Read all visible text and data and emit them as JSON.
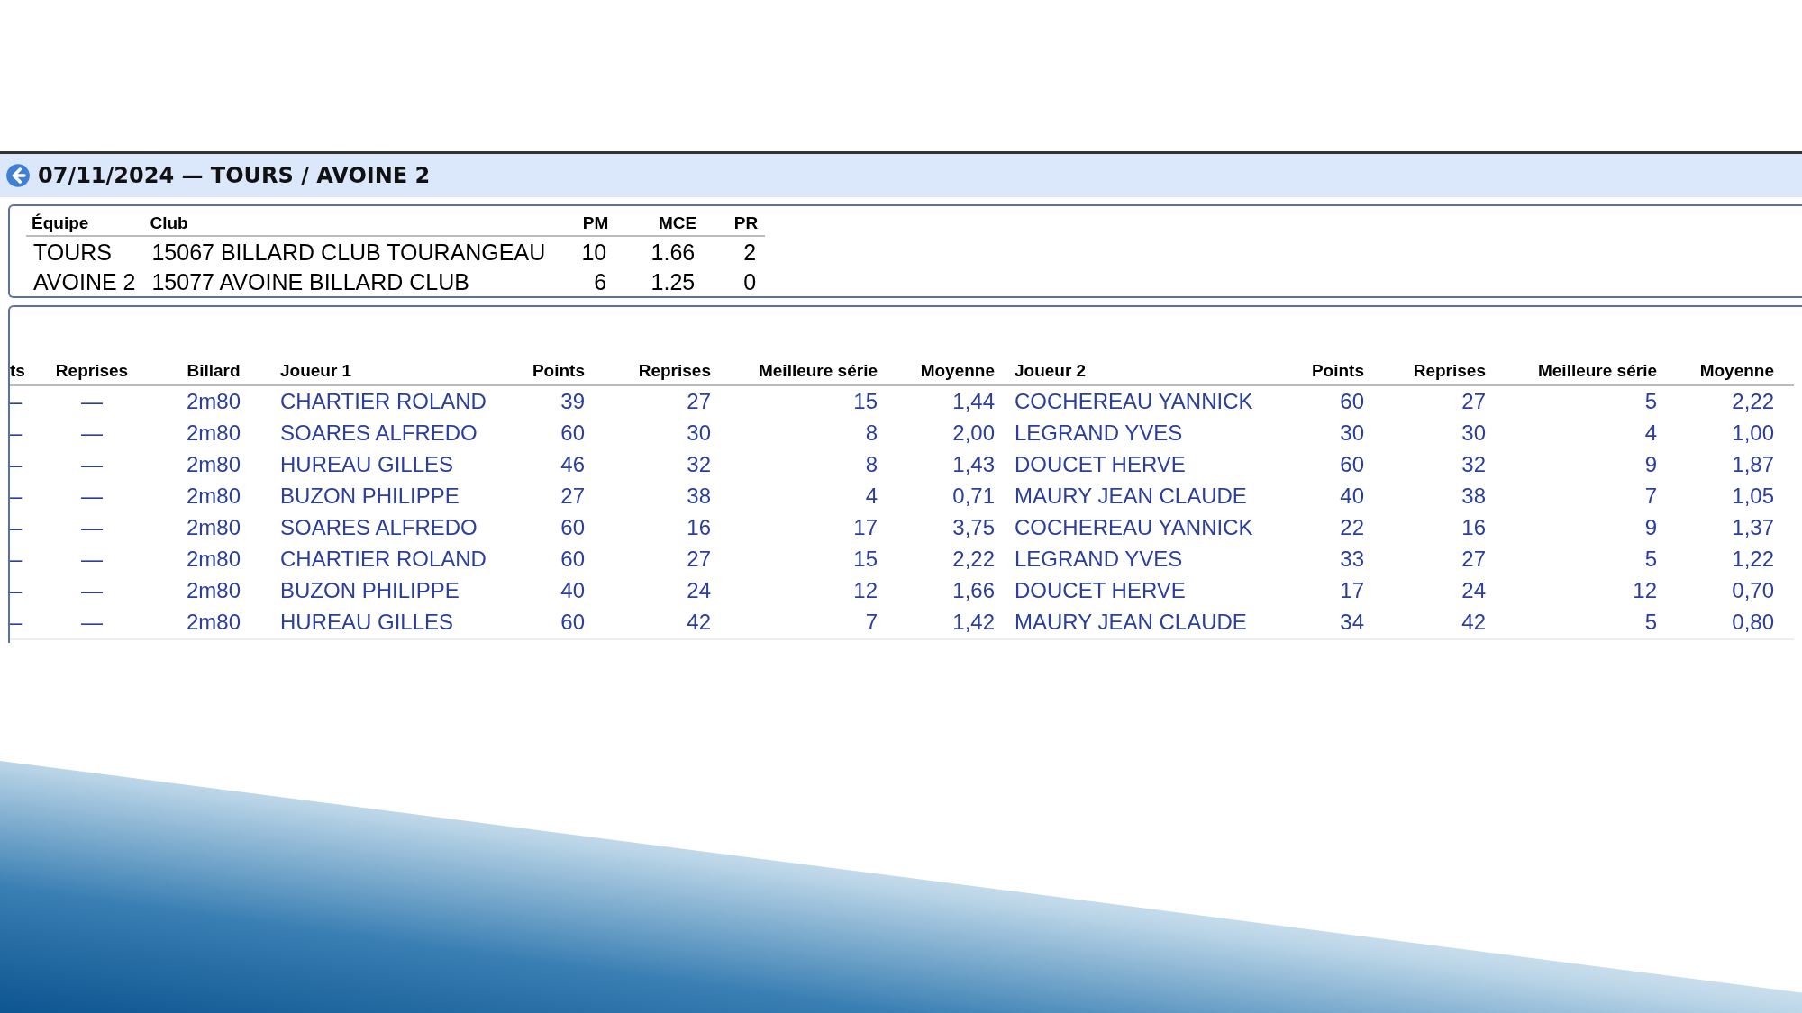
{
  "header": {
    "title": "07/11/2024 — TOURS / AVOINE 2"
  },
  "teams": {
    "columns": [
      "Équipe",
      "Club",
      "PM",
      "MCE",
      "PR"
    ],
    "rows": [
      [
        "TOURS",
        "15067 BILLARD CLUB TOURANGEAU",
        "10",
        "1.66",
        "2"
      ],
      [
        "AVOINE 2",
        "15077 AVOINE BILLARD CLUB",
        "6",
        "1.25",
        "0"
      ]
    ]
  },
  "matches": {
    "columns": [
      "ts",
      "Reprises",
      "Billard",
      "Joueur 1",
      "Points",
      "Reprises",
      "Meilleure série",
      "Moyenne",
      "Joueur 2",
      "Points",
      "Reprises",
      "Meilleure série",
      "Moyenne"
    ],
    "rows": [
      [
        "–",
        "—",
        "2m80",
        "CHARTIER ROLAND",
        "39",
        "27",
        "15",
        "1,44",
        "COCHEREAU YANNICK",
        "60",
        "27",
        "5",
        "2,22"
      ],
      [
        "–",
        "—",
        "2m80",
        "SOARES ALFREDO",
        "60",
        "30",
        "8",
        "2,00",
        "LEGRAND YVES",
        "30",
        "30",
        "4",
        "1,00"
      ],
      [
        "–",
        "—",
        "2m80",
        "HUREAU GILLES",
        "46",
        "32",
        "8",
        "1,43",
        "DOUCET HERVE",
        "60",
        "32",
        "9",
        "1,87"
      ],
      [
        "–",
        "—",
        "2m80",
        "BUZON PHILIPPE",
        "27",
        "38",
        "4",
        "0,71",
        "MAURY JEAN CLAUDE",
        "40",
        "38",
        "7",
        "1,05"
      ],
      [
        "–",
        "—",
        "2m80",
        "SOARES ALFREDO",
        "60",
        "16",
        "17",
        "3,75",
        "COCHEREAU YANNICK",
        "22",
        "16",
        "9",
        "1,37"
      ],
      [
        "–",
        "—",
        "2m80",
        "CHARTIER ROLAND",
        "60",
        "27",
        "15",
        "2,22",
        "LEGRAND YVES",
        "33",
        "27",
        "5",
        "1,22"
      ],
      [
        "–",
        "—",
        "2m80",
        "BUZON PHILIPPE",
        "40",
        "24",
        "12",
        "1,66",
        "DOUCET HERVE",
        "17",
        "24",
        "12",
        "0,70"
      ],
      [
        "–",
        "—",
        "2m80",
        "HUREAU GILLES",
        "60",
        "42",
        "7",
        "1,42",
        "MAURY JEAN CLAUDE",
        "34",
        "42",
        "5",
        "0,80"
      ]
    ]
  }
}
